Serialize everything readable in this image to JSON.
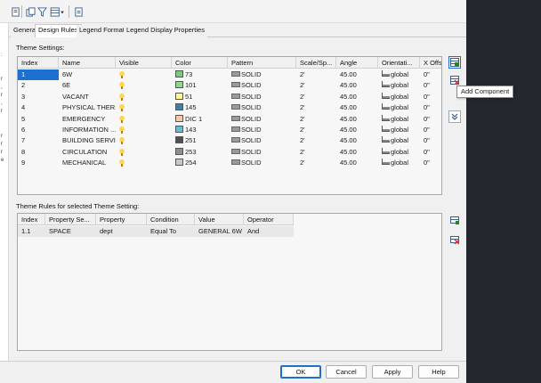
{
  "left_strip": {
    "fragments": [
      ":",
      "r",
      ",",
      "r",
      ",",
      "r",
      "r",
      "r",
      "r",
      "e"
    ]
  },
  "tabs": [
    {
      "label": "General",
      "active": false
    },
    {
      "label": "Design Rules",
      "active": true
    },
    {
      "label": "Legend Format",
      "active": false
    },
    {
      "label": "Legend Display Properties",
      "active": false
    }
  ],
  "theme_settings": {
    "label": "Theme Settings:",
    "columns": [
      "Index",
      "Name",
      "Visible",
      "Color",
      "Pattern",
      "Scale/Sp...",
      "Angle",
      "Orientati...",
      "X Offs"
    ],
    "rows": [
      {
        "index": "1",
        "name": "6W",
        "color": "73",
        "swatch": "#7fc97f",
        "pattern": "SOLID",
        "scale": "2'",
        "angle": "45.00",
        "orientation": "global",
        "xoff": "0\""
      },
      {
        "index": "2",
        "name": "6E",
        "color": "101",
        "swatch": "#8fd68f",
        "pattern": "SOLID",
        "scale": "2'",
        "angle": "45.00",
        "orientation": "global",
        "xoff": "0\""
      },
      {
        "index": "3",
        "name": "VACANT",
        "color": "51",
        "swatch": "#fff59a",
        "pattern": "SOLID",
        "scale": "2'",
        "angle": "45.00",
        "orientation": "global",
        "xoff": "0\""
      },
      {
        "index": "4",
        "name": "PHYSICAL THER...",
        "color": "145",
        "swatch": "#3f7f9f",
        "pattern": "SOLID",
        "scale": "2'",
        "angle": "45.00",
        "orientation": "global",
        "xoff": "0\""
      },
      {
        "index": "5",
        "name": "EMERGENCY",
        "color": "DIC 1",
        "swatch": "#f5cba7",
        "pattern": "SOLID",
        "scale": "2'",
        "angle": "45.00",
        "orientation": "global",
        "xoff": "0\""
      },
      {
        "index": "6",
        "name": "INFORMATION ...",
        "color": "143",
        "swatch": "#6fb7d7",
        "pattern": "SOLID",
        "scale": "2'",
        "angle": "45.00",
        "orientation": "global",
        "xoff": "0\""
      },
      {
        "index": "7",
        "name": "BUILDING SERVI...",
        "color": "251",
        "swatch": "#4f4f4f",
        "pattern": "SOLID",
        "scale": "2'",
        "angle": "45.00",
        "orientation": "global",
        "xoff": "0\""
      },
      {
        "index": "8",
        "name": "CIRCULATION",
        "color": "253",
        "swatch": "#8f8f8f",
        "pattern": "SOLID",
        "scale": "2'",
        "angle": "45.00",
        "orientation": "global",
        "xoff": "0\""
      },
      {
        "index": "9",
        "name": "MECHANICAL",
        "color": "254",
        "swatch": "#c8c8c8",
        "pattern": "SOLID",
        "scale": "2'",
        "angle": "45.00",
        "orientation": "global",
        "xoff": "0\""
      }
    ]
  },
  "theme_rules": {
    "label": "Theme Rules for selected Theme Setting:",
    "columns": [
      "Index",
      "Property Se...",
      "Property",
      "Condition",
      "Value",
      "Operator"
    ],
    "rows": [
      {
        "index": "1.1",
        "property_set": "SPACE",
        "property": "dept",
        "condition": "Equal To",
        "value": "GENERAL 6W",
        "operator": "And"
      }
    ]
  },
  "tooltip": {
    "text": "Add Component"
  },
  "footer": {
    "ok": "OK",
    "cancel": "Cancel",
    "apply": "Apply",
    "help": "Help"
  },
  "colors": {
    "selection": "#1d6fd0",
    "dialog_bg": "#f0f0f0",
    "desktop_bg": "#23272e"
  }
}
